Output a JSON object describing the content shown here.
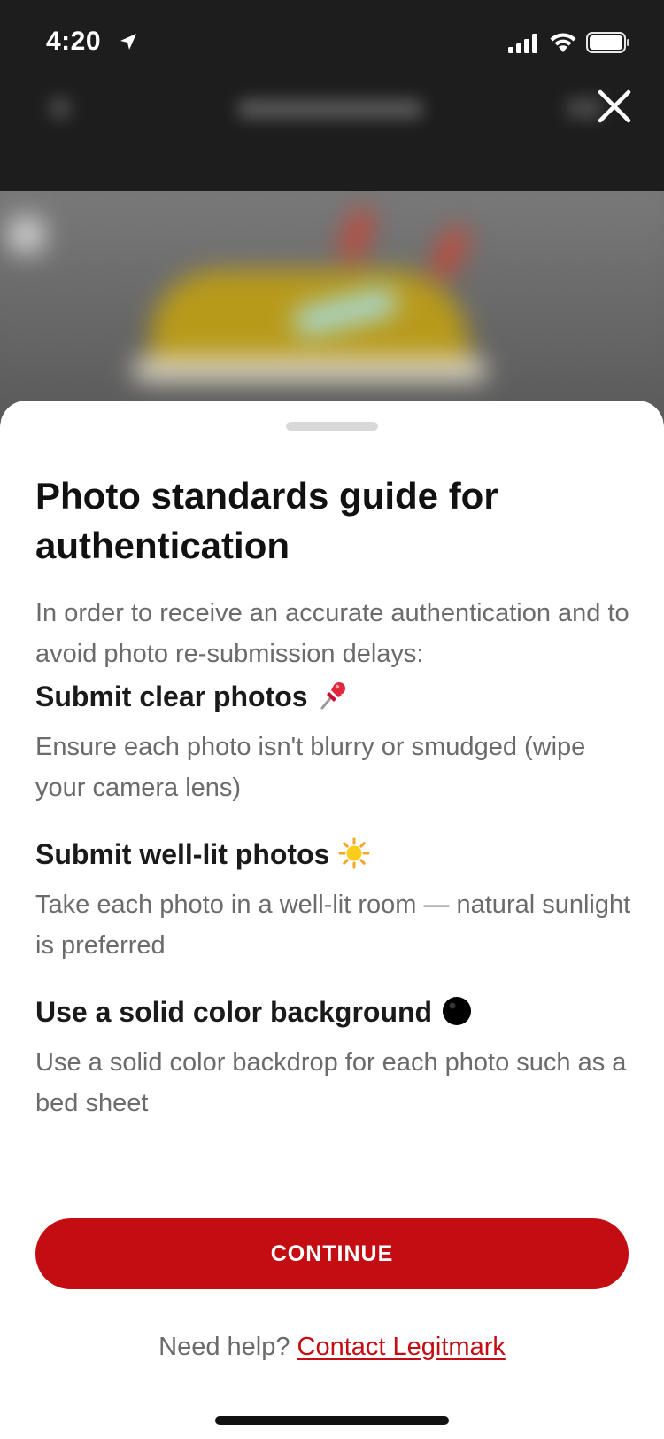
{
  "status_bar": {
    "time": "4:20"
  },
  "icons": {
    "location": "location-arrow-icon",
    "signal": "cellular-signal-icon",
    "wifi": "wifi-icon",
    "battery": "battery-icon",
    "close": "close-icon"
  },
  "sheet": {
    "title": "Photo standards guide for authentication",
    "intro": "In order to receive an accurate authentication and to avoid photo re-submission delays:",
    "tips": [
      {
        "heading": "Submit clear photos",
        "emoji": "pushpin-icon",
        "body": "Ensure each photo isn't blurry or smudged (wipe your camera lens)"
      },
      {
        "heading": "Submit well-lit photos",
        "emoji": "sun-icon",
        "body": "Take each photo in a well-lit room — natural sunlight is preferred"
      },
      {
        "heading": "Use a solid color background",
        "emoji": "black-circle-icon",
        "body": "Use a solid color backdrop for each photo such as a bed sheet"
      }
    ],
    "continue_label": "CONTINUE",
    "help_prefix": "Need help?",
    "help_link": "Contact Legitmark"
  },
  "colors": {
    "accent": "#c40d13",
    "title_text": "#111111",
    "body_text": "#6b6b6b",
    "sheet_background": "#ffffff",
    "backdrop": "#1d1d1d"
  }
}
